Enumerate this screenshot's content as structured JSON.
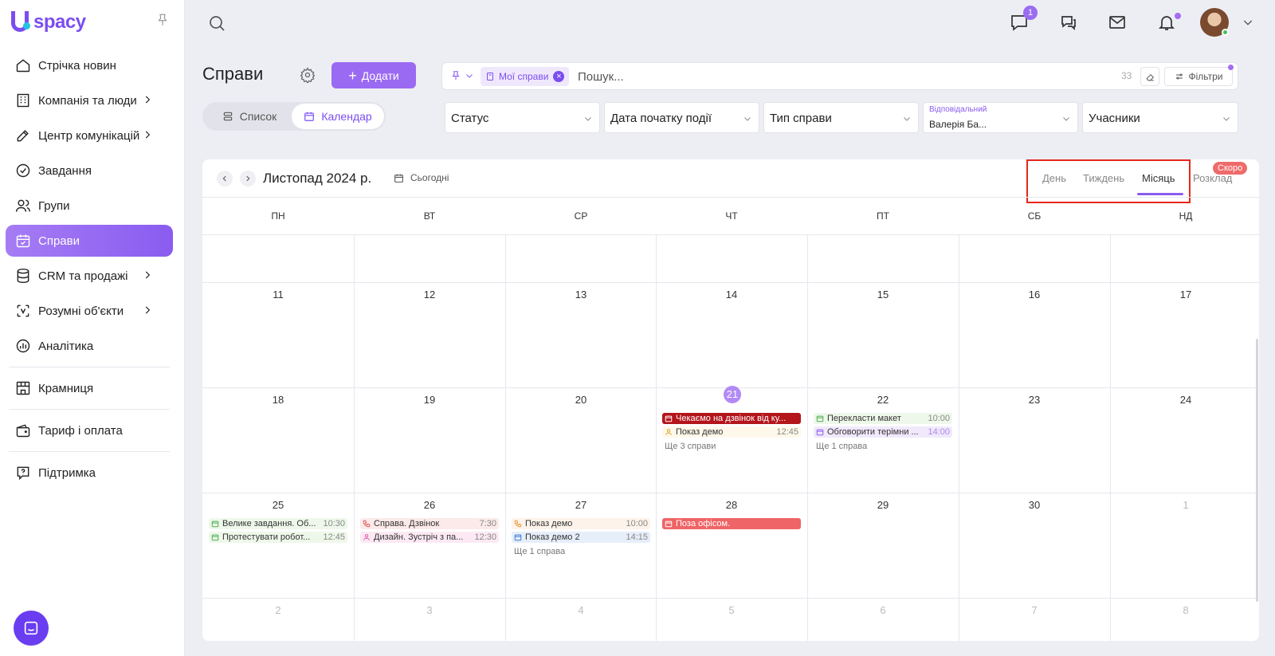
{
  "sidebar": {
    "logo_text": "spacy",
    "items": [
      {
        "label": "Стрічка новин",
        "icon": "home-icon"
      },
      {
        "label": "Компанія та люди",
        "icon": "building-icon",
        "chevron": true
      },
      {
        "label": "Центр комунікацій",
        "icon": "edit-icon",
        "chevron": true
      },
      {
        "label": "Завдання",
        "icon": "check-circle-icon"
      },
      {
        "label": "Групи",
        "icon": "users-icon"
      },
      {
        "label": "Справи",
        "icon": "calendar-check-icon",
        "active": true
      },
      {
        "label": "CRM та продажі",
        "icon": "database-icon",
        "chevron": true
      },
      {
        "label": "Розумні об'єкти",
        "icon": "scan-icon",
        "chevron": true
      },
      {
        "label": "Аналітика",
        "icon": "chart-icon"
      },
      {
        "label": "Крамниця",
        "icon": "store-icon"
      },
      {
        "label": "Тариф і оплата",
        "icon": "wallet-icon"
      },
      {
        "label": "Підтримка",
        "icon": "help-icon"
      }
    ]
  },
  "header": {
    "messages_badge": "1"
  },
  "page": {
    "title": "Справи",
    "add_label": "Додати",
    "view_list": "Список",
    "view_calendar": "Календар"
  },
  "search": {
    "chip": "Мої справи",
    "placeholder": "Пошук...",
    "count": "33",
    "filters_label": "Фільтри"
  },
  "filters": {
    "status": "Статус",
    "start_date": "Дата початку події",
    "type": "Тип справи",
    "responsible_label": "Відповідальний",
    "responsible_value": "Валерія Ба...",
    "participants": "Учасники"
  },
  "calendar": {
    "title": "Листопад 2024 р.",
    "today_label": "Сьогодні",
    "tabs": {
      "day": "День",
      "week": "Тиждень",
      "month": "Місяць",
      "schedule": "Розклад"
    },
    "soon_badge": "Скоро",
    "weekdays": [
      "ПН",
      "ВТ",
      "СР",
      "ЧТ",
      "ПТ",
      "СБ",
      "НД"
    ],
    "rows": [
      [
        "",
        "",
        "",
        "",
        "",
        "",
        ""
      ],
      [
        "11",
        "12",
        "13",
        "14",
        "15",
        "16",
        "17"
      ],
      [
        "18",
        "19",
        "20",
        "21",
        "22",
        "23",
        "24"
      ],
      [
        "25",
        "26",
        "27",
        "28",
        "29",
        "30",
        "1"
      ],
      [
        "2",
        "3",
        "4",
        "5",
        "6",
        "7",
        "8"
      ]
    ],
    "today": "21",
    "events": {
      "thu21_1": "Чекаємо на дзвінок від ку...",
      "thu21_2": "Показ демо",
      "thu21_2_time": "12:45",
      "thu21_more": "Ще 3 справи",
      "fri22_1": "Перекласти макет",
      "fri22_1_time": "10:00",
      "fri22_2": "Обговорити терімни ...",
      "fri22_2_time": "14:00",
      "fri22_more": "Ще 1 справа",
      "mon25_1": "Велике завдання. Об...",
      "mon25_1_time": "10:30",
      "mon25_2": "Протестувати робот...",
      "mon25_2_time": "12:45",
      "tue26_1": "Справа. Дзвінок",
      "tue26_1_time": "7:30",
      "tue26_2": "Дизайн. Зустріч з па...",
      "tue26_2_time": "12:30",
      "wed27_1": "Показ демо",
      "wed27_1_time": "10:00",
      "wed27_2": "Показ демо 2",
      "wed27_2_time": "14:15",
      "wed27_more": "Ще 1 справа",
      "thu28_1": "Поза офісом."
    }
  },
  "colors": {
    "accent": "#8a5cf0",
    "event_red": "#b3151b",
    "highlight": "#e5271b"
  }
}
